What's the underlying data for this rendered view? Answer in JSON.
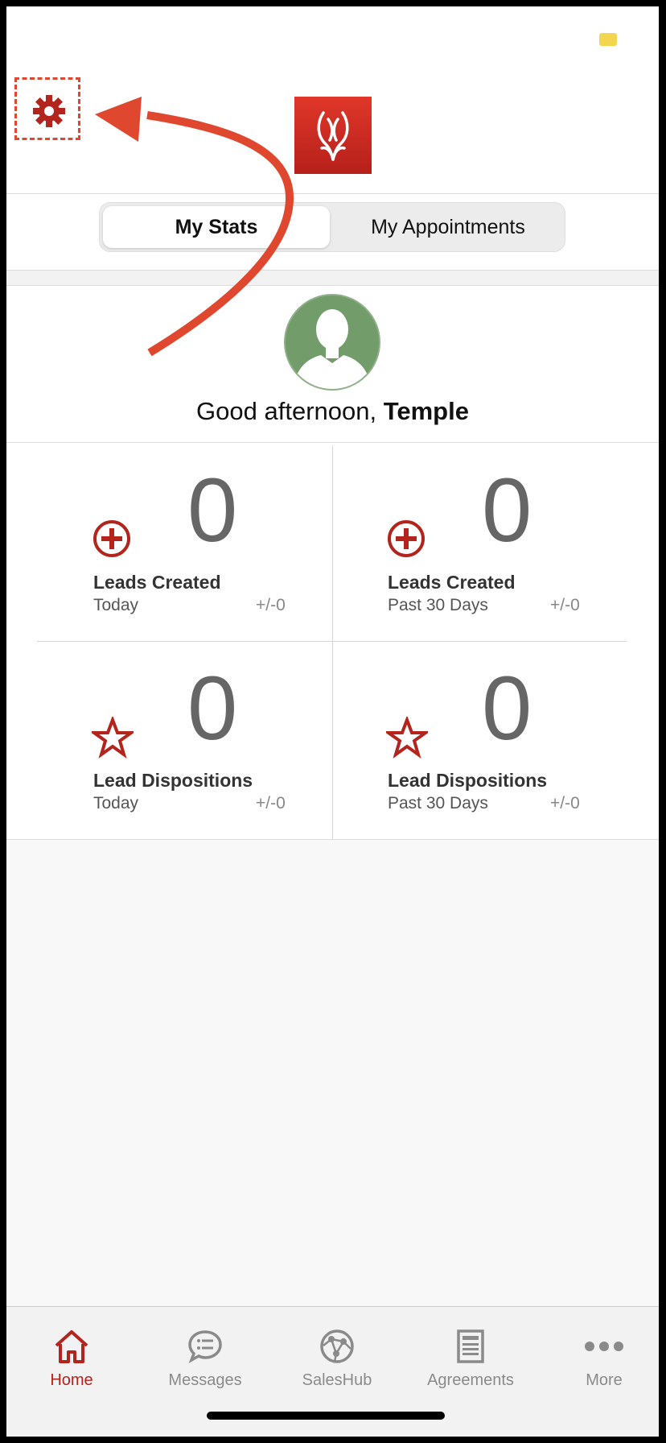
{
  "header": {
    "settings_icon": "gear-icon",
    "logo_icon": "brand-logo"
  },
  "segment": {
    "tabs": [
      {
        "label": "My Stats",
        "active": true
      },
      {
        "label": "My Appointments",
        "active": false
      }
    ]
  },
  "profile": {
    "greeting_prefix": "Good afternoon, ",
    "user_name": "Temple"
  },
  "stats": [
    {
      "icon": "plus-circle-icon",
      "value": "0",
      "label": "Leads Created",
      "period": "Today",
      "delta": "+/-0"
    },
    {
      "icon": "plus-circle-icon",
      "value": "0",
      "label": "Leads Created",
      "period": "Past 30 Days",
      "delta": "+/-0"
    },
    {
      "icon": "star-icon",
      "value": "0",
      "label": "Lead Dispositions",
      "period": "Today",
      "delta": "+/-0"
    },
    {
      "icon": "star-icon",
      "value": "0",
      "label": "Lead Dispositions",
      "period": "Past 30 Days",
      "delta": "+/-0"
    }
  ],
  "tabbar": {
    "items": [
      {
        "label": "Home",
        "icon": "home-icon",
        "active": true
      },
      {
        "label": "Messages",
        "icon": "chat-icon",
        "active": false
      },
      {
        "label": "SalesHub",
        "icon": "globe-icon",
        "active": false
      },
      {
        "label": "Agreements",
        "icon": "document-icon",
        "active": false
      },
      {
        "label": "More",
        "icon": "more-icon",
        "active": false
      }
    ]
  },
  "colors": {
    "accent": "#b3241c",
    "annotation": "#e0472f",
    "avatar": "#739c6b"
  }
}
